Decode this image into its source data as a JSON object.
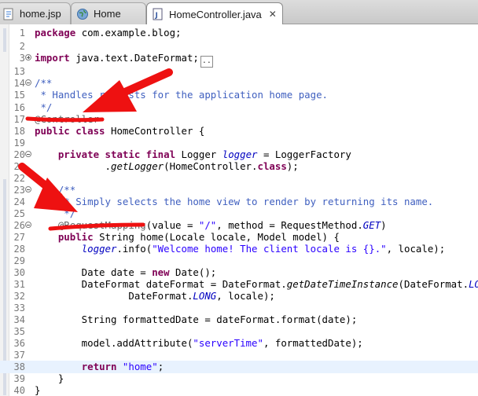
{
  "tabs": [
    {
      "label": "home.jsp",
      "icon": "jsp-file-icon",
      "active": false
    },
    {
      "label": "Home",
      "icon": "globe-icon",
      "active": false
    },
    {
      "label": "HomeController.java",
      "icon": "java-file-icon",
      "active": true,
      "close": "✕"
    }
  ],
  "editor": {
    "lines": [
      {
        "n": "1",
        "parts": [
          [
            "kw",
            "package"
          ],
          [
            "",
            "com.example.blog;"
          ]
        ]
      },
      {
        "n": "2",
        "parts": []
      },
      {
        "n": "3",
        "parts": [
          [
            "kw",
            "import"
          ],
          [
            "",
            "java.text.DateFormat;"
          ]
        ]
      },
      {
        "n": "13",
        "parts": []
      },
      {
        "n": "14",
        "parts": [
          [
            "cm",
            "/**"
          ]
        ]
      },
      {
        "n": "15",
        "parts": [
          [
            "cm",
            " * Handles requests for the application home page."
          ]
        ]
      },
      {
        "n": "16",
        "parts": [
          [
            "cm",
            " */"
          ]
        ]
      },
      {
        "n": "17",
        "parts": [
          [
            "ann",
            "@Controller"
          ]
        ]
      },
      {
        "n": "18",
        "parts": [
          [
            "kw",
            "public class"
          ],
          [
            "",
            " HomeController {"
          ]
        ]
      },
      {
        "n": "19",
        "parts": []
      },
      {
        "n": "20",
        "parts": [
          [
            "",
            "    "
          ],
          [
            "kw",
            "private static final"
          ],
          [
            "",
            " Logger "
          ],
          [
            "fld",
            "logger"
          ],
          [
            "",
            " = LoggerFactory"
          ]
        ]
      },
      {
        "n": "21",
        "parts": [
          [
            "",
            "            ."
          ],
          [
            "it",
            "getLogger"
          ],
          [
            "",
            "(HomeController."
          ],
          [
            "kw",
            "class"
          ],
          [
            "",
            ");"
          ]
        ]
      },
      {
        "n": "22",
        "parts": []
      },
      {
        "n": "23",
        "parts": [
          [
            "cm",
            "    /**"
          ]
        ]
      },
      {
        "n": "24",
        "parts": [
          [
            "cm",
            "     * Simply selects the home view to render by returning its name."
          ]
        ]
      },
      {
        "n": "25",
        "parts": [
          [
            "cm",
            "     */"
          ]
        ]
      },
      {
        "n": "26",
        "parts": [
          [
            "",
            "    "
          ],
          [
            "ann",
            "@RequestMapping"
          ],
          [
            "",
            "(value = "
          ],
          [
            "str",
            "\"/\""
          ],
          [
            "",
            ", method = RequestMethod."
          ],
          [
            "fld",
            "GET"
          ],
          [
            "",
            ")"
          ]
        ]
      },
      {
        "n": "27",
        "parts": [
          [
            "",
            "    "
          ],
          [
            "kw",
            "public"
          ],
          [
            "",
            " String home(Locale locale, Model model) {"
          ]
        ]
      },
      {
        "n": "28",
        "parts": [
          [
            "",
            "        "
          ],
          [
            "fld",
            "logger"
          ],
          [
            "",
            ".info("
          ],
          [
            "str",
            "\"Welcome home! The client locale is {}.\""
          ],
          [
            "",
            ", locale);"
          ]
        ]
      },
      {
        "n": "29",
        "parts": []
      },
      {
        "n": "30",
        "parts": [
          [
            "",
            "        Date date = "
          ],
          [
            "kw",
            "new"
          ],
          [
            "",
            " Date();"
          ]
        ]
      },
      {
        "n": "31",
        "parts": [
          [
            "",
            "        DateFormat dateFormat = DateFormat."
          ],
          [
            "it",
            "getDateTimeInstance"
          ],
          [
            "",
            "(DateFormat."
          ],
          [
            "fld",
            "LONG"
          ],
          [
            "",
            ","
          ]
        ]
      },
      {
        "n": "32",
        "parts": [
          [
            "",
            "                DateFormat."
          ],
          [
            "fld",
            "LONG"
          ],
          [
            "",
            ", locale);"
          ]
        ]
      },
      {
        "n": "33",
        "parts": []
      },
      {
        "n": "34",
        "parts": [
          [
            "",
            "        String formattedDate = dateFormat.format(date);"
          ]
        ]
      },
      {
        "n": "35",
        "parts": []
      },
      {
        "n": "36",
        "parts": [
          [
            "",
            "        model.addAttribute("
          ],
          [
            "str",
            "\"serverTime\""
          ],
          [
            "",
            ", formattedDate);"
          ]
        ]
      },
      {
        "n": "37",
        "parts": []
      },
      {
        "n": "38",
        "parts": [
          [
            "",
            "        "
          ],
          [
            "kw",
            "return"
          ],
          [
            "",
            " "
          ],
          [
            "str",
            "\"home\""
          ],
          [
            "",
            ";"
          ]
        ]
      },
      {
        "n": "39",
        "parts": [
          [
            "",
            "    }"
          ]
        ]
      },
      {
        "n": "40",
        "parts": [
          [
            "",
            "}"
          ]
        ]
      }
    ]
  }
}
